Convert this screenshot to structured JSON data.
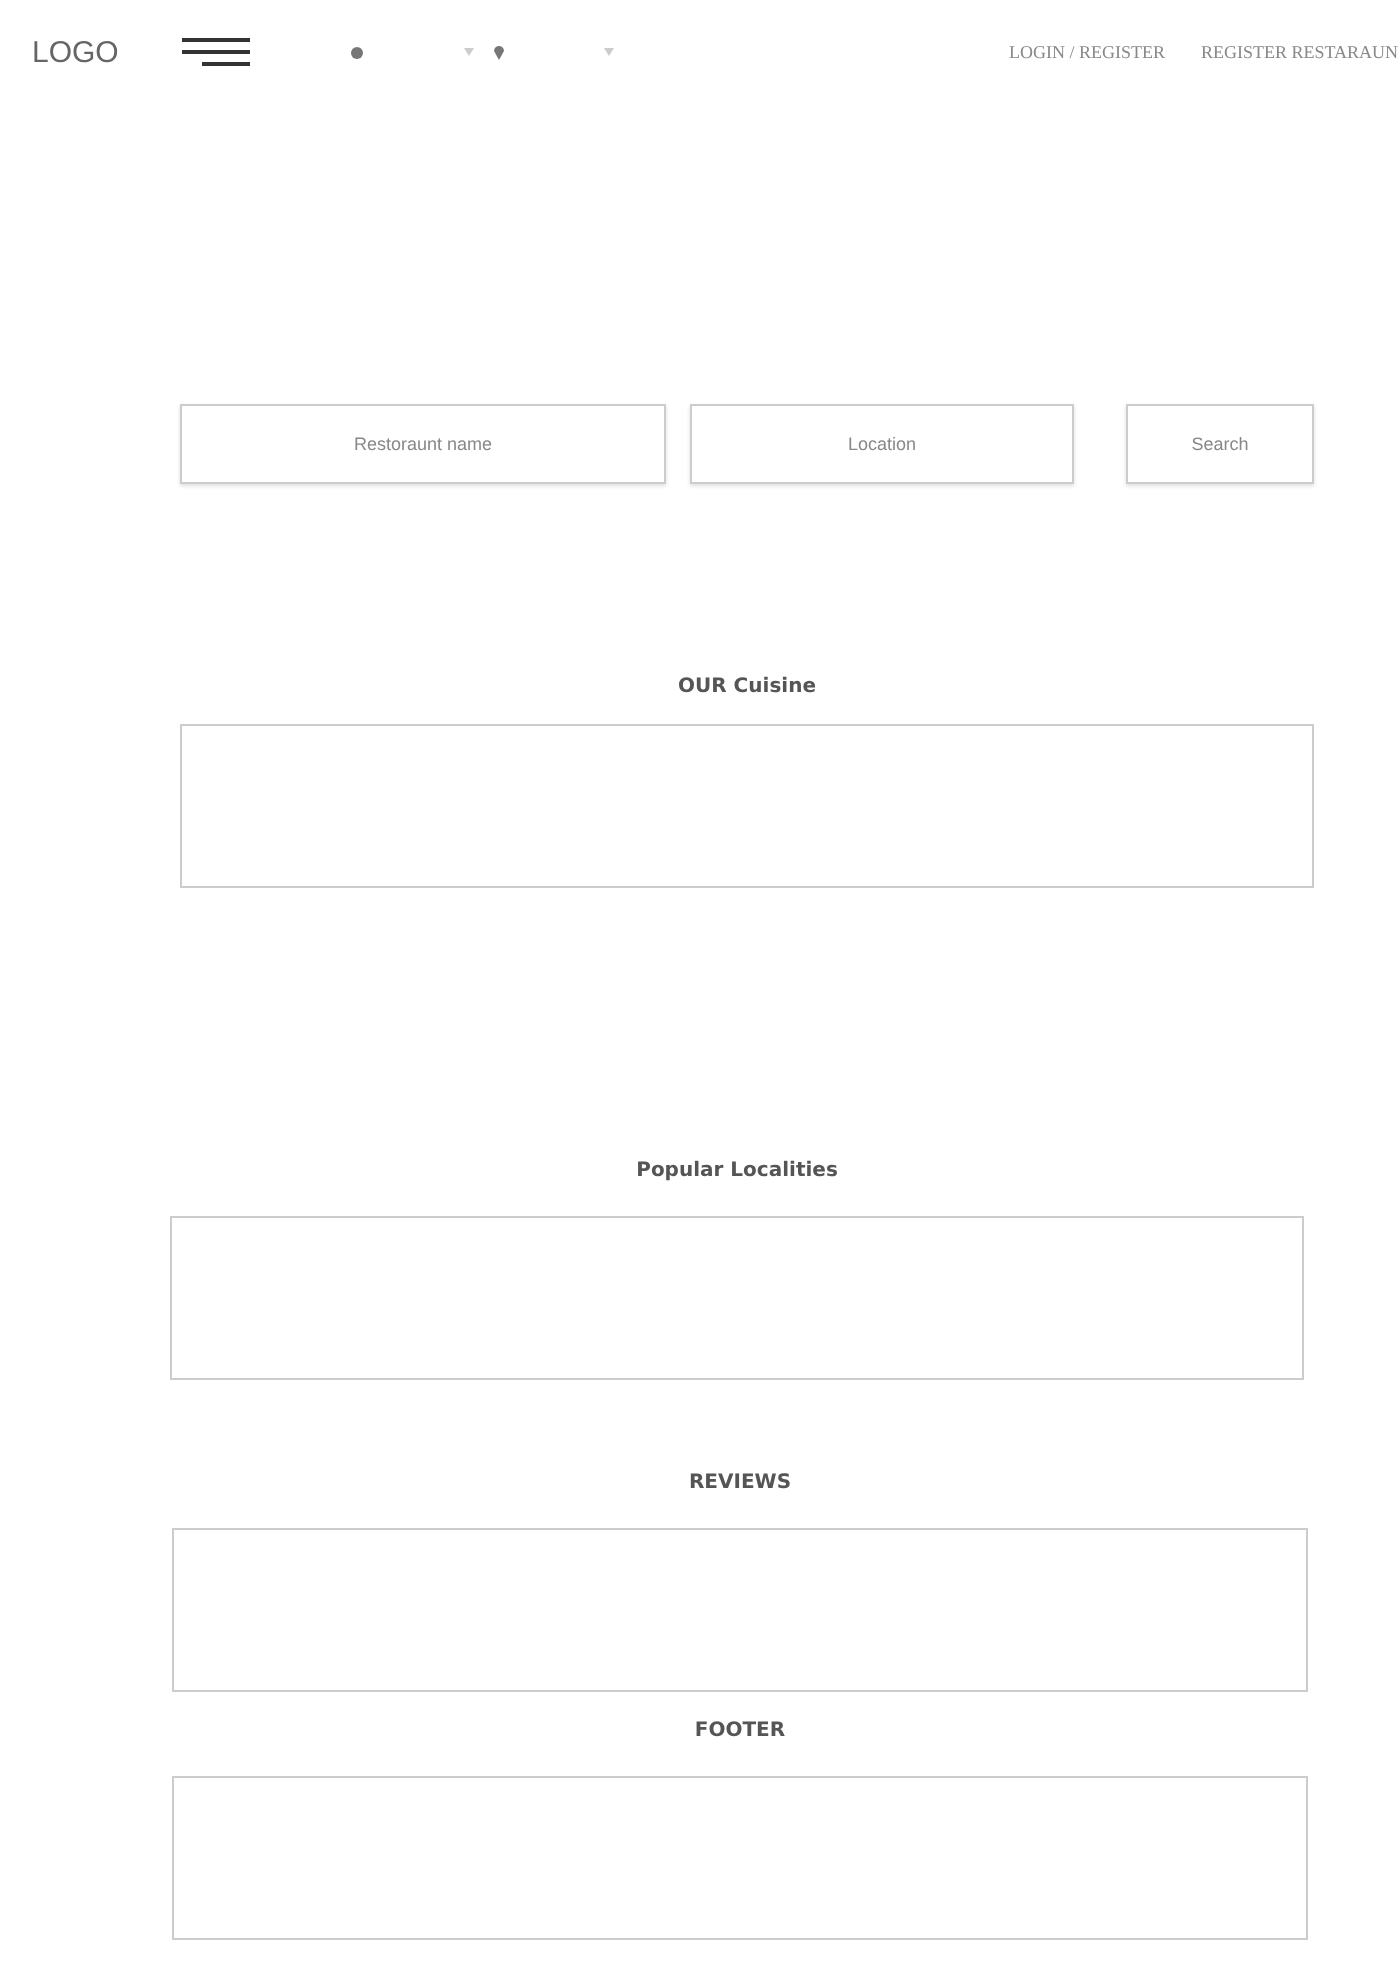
{
  "header": {
    "logo": "LOGO",
    "links": [
      "LOGIN / REGISTER",
      "REGISTER RESTARAUN"
    ]
  },
  "search": {
    "fields": [
      {
        "placeholder": "Restoraunt name"
      },
      {
        "placeholder": "Location"
      }
    ],
    "button": "Search"
  },
  "sections": [
    {
      "title": "OUR Cuisine"
    },
    {
      "title": "Popular Localities"
    },
    {
      "title": "REVIEWS"
    },
    {
      "title": "FOOTER"
    }
  ]
}
